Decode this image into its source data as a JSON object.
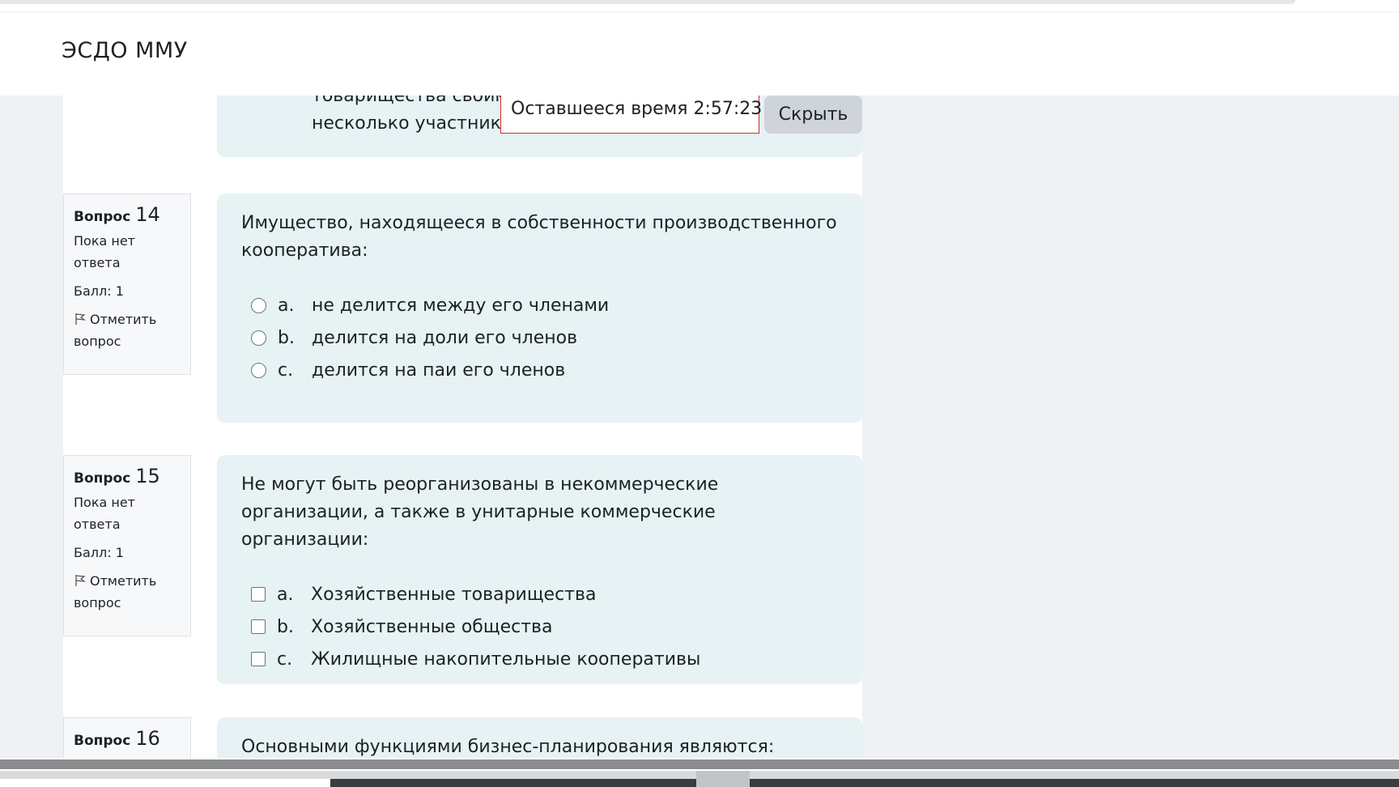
{
  "navbar": {
    "brand": "ЭСДО ММУ"
  },
  "timer": {
    "label": "Оставшееся время 2:57:23",
    "hide_button": "Скрыть"
  },
  "previous_question": {
    "line1": "товарищества своим",
    "line2": "несколько участнико"
  },
  "questions": [
    {
      "label": "Вопрос",
      "number": "14",
      "state": "Пока нет ответа",
      "grade": "Балл: 1",
      "flag": "Отметить вопрос",
      "prompt": "Имущество, находящееся в собственности производственного кооператива:",
      "input_type": "radio",
      "answers": [
        {
          "letter": "a.",
          "text": "не делится между его членами"
        },
        {
          "letter": "b.",
          "text": "делится на доли его членов"
        },
        {
          "letter": "c.",
          "text": "делится на паи его членов"
        }
      ]
    },
    {
      "label": "Вопрос",
      "number": "15",
      "state": "Пока нет ответа",
      "grade": "Балл: 1",
      "flag": "Отметить вопрос",
      "prompt": "Не могут быть реорганизованы в некоммерческие организации, а также в унитарные коммерческие организации:",
      "input_type": "checkbox",
      "answers": [
        {
          "letter": "a.",
          "text": "Хозяйственные товарищества"
        },
        {
          "letter": "b.",
          "text": "Хозяйственные общества"
        },
        {
          "letter": "c.",
          "text": "Жилищные накопительные кооперативы"
        }
      ]
    },
    {
      "label": "Вопрос",
      "number": "16",
      "prompt": "Основными функциями бизнес-планирования являются:"
    }
  ]
}
